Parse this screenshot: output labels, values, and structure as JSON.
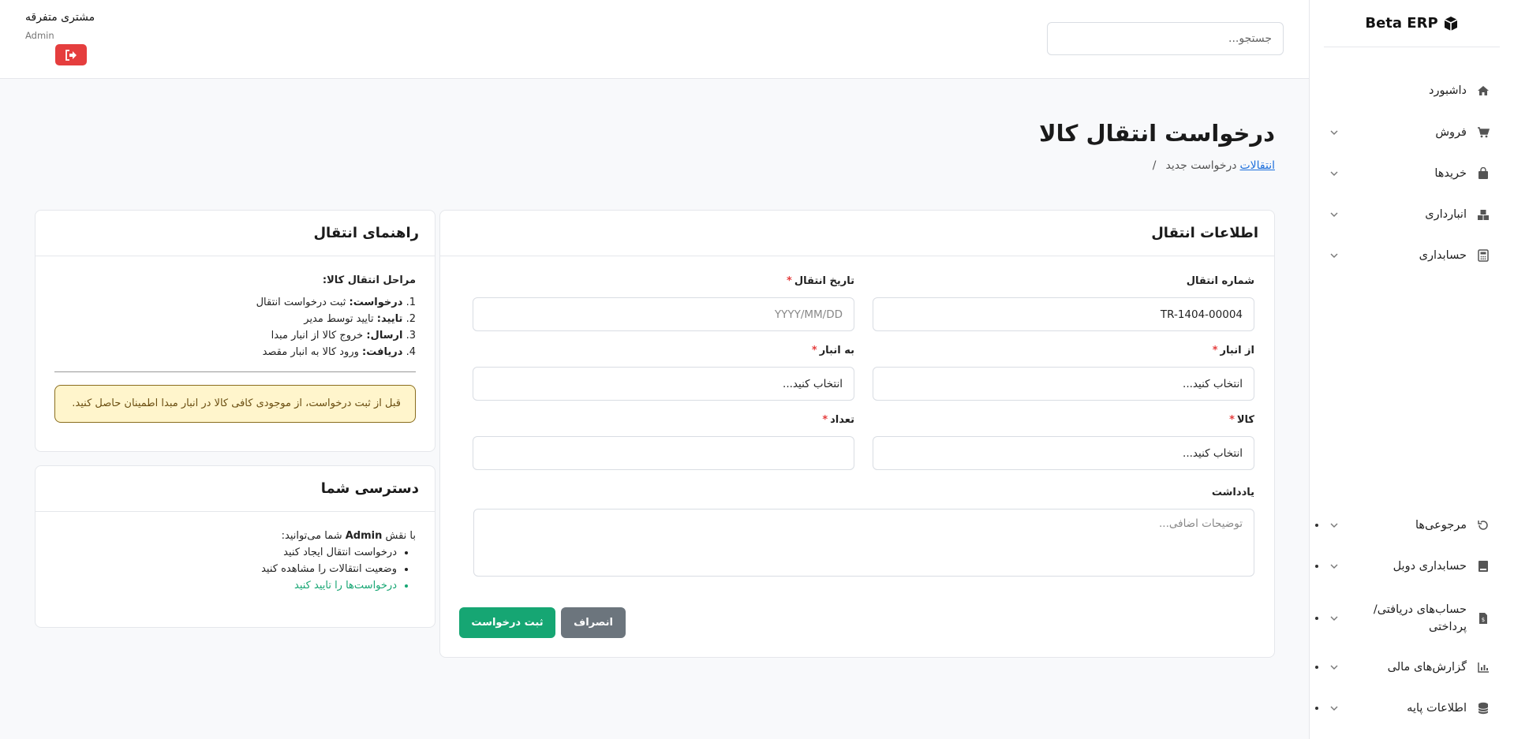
{
  "app": {
    "brand": "Beta ERP"
  },
  "sidebar": {
    "items": [
      {
        "label": "داشبورد",
        "icon": "home-icon",
        "chevron": false
      },
      {
        "label": "فروش",
        "icon": "cart-icon",
        "chevron": true
      },
      {
        "label": "خریدها",
        "icon": "bag-icon",
        "chevron": true
      },
      {
        "label": "انبارداری",
        "icon": "boxes-icon",
        "chevron": true
      },
      {
        "label": "حسابداری",
        "icon": "calculator-icon",
        "chevron": true
      },
      {
        "label": "مرجوعی‌ها",
        "icon": "undo-icon",
        "chevron": true
      },
      {
        "label": "حسابداری دوبل",
        "icon": "book-icon",
        "chevron": true
      },
      {
        "label": "حساب‌های دریافتی/پرداختی",
        "icon": "invoice-icon",
        "chevron": true
      },
      {
        "label": "گزارش‌های مالی",
        "icon": "chart-icon",
        "chevron": true
      },
      {
        "label": "اطلاعات پایه",
        "icon": "database-icon",
        "chevron": true
      }
    ]
  },
  "header": {
    "search_placeholder": "جستجو...",
    "user_name": "مشتری متفرقه",
    "user_role": "Admin"
  },
  "page": {
    "title": "درخواست انتقال کالا",
    "breadcrumb_link": "انتقالات",
    "breadcrumb_current": "درخواست جدید",
    "breadcrumb_sep": "/"
  },
  "form": {
    "title": "اطلاعات انتقال",
    "transfer_number_label": "شماره انتقال",
    "transfer_number_value": "TR-1404-00004",
    "transfer_date_label": "تاریخ انتقال",
    "transfer_date_placeholder": "YYYY/MM/DD",
    "from_warehouse_label": "از انبار",
    "from_warehouse_value": "انتخاب کنید...",
    "to_warehouse_label": "به انبار",
    "to_warehouse_value": "انتخاب کنید...",
    "product_label": "کالا",
    "product_value": "انتخاب کنید...",
    "quantity_label": "تعداد",
    "quantity_value": "",
    "note_label": "یادداشت",
    "note_placeholder": "توضیحات اضافی...",
    "required_mark": "*",
    "submit_label": "ثبت درخواست",
    "cancel_label": "انصراف"
  },
  "guide": {
    "title": "راهنمای انتقال",
    "steps_title": "مراحل انتقال کالا:",
    "steps": [
      {
        "num": "1.",
        "term": "درخواست:",
        "desc": "ثبت درخواست انتقال"
      },
      {
        "num": "2.",
        "term": "تایید:",
        "desc": "تایید توسط مدیر"
      },
      {
        "num": "3.",
        "term": "ارسال:",
        "desc": "خروج کالا از انبار مبدا"
      },
      {
        "num": "4.",
        "term": "دریافت:",
        "desc": "ورود کالا به انبار مقصد"
      }
    ],
    "alert": "قبل از ثبت درخواست، از موجودی کافی کالا در انبار مبدا اطمینان حاصل کنید."
  },
  "access": {
    "title": "دسترسی شما",
    "intro_prefix": "با نقش",
    "role": "Admin",
    "intro_suffix": "شما می‌توانید:",
    "items": [
      {
        "text": "درخواست انتقال ایجاد کنید",
        "highlight": false
      },
      {
        "text": "وضعیت انتقالات را مشاهده کنید",
        "highlight": false
      },
      {
        "text": "درخواست‌ها را تایید کنید",
        "highlight": true
      }
    ]
  },
  "colors": {
    "primary_green": "#16a673",
    "danger_red": "#e53e3e",
    "link_blue": "#1d6fdc",
    "alert_bg": "#fff5cc",
    "cancel_gray": "#6c757d"
  }
}
